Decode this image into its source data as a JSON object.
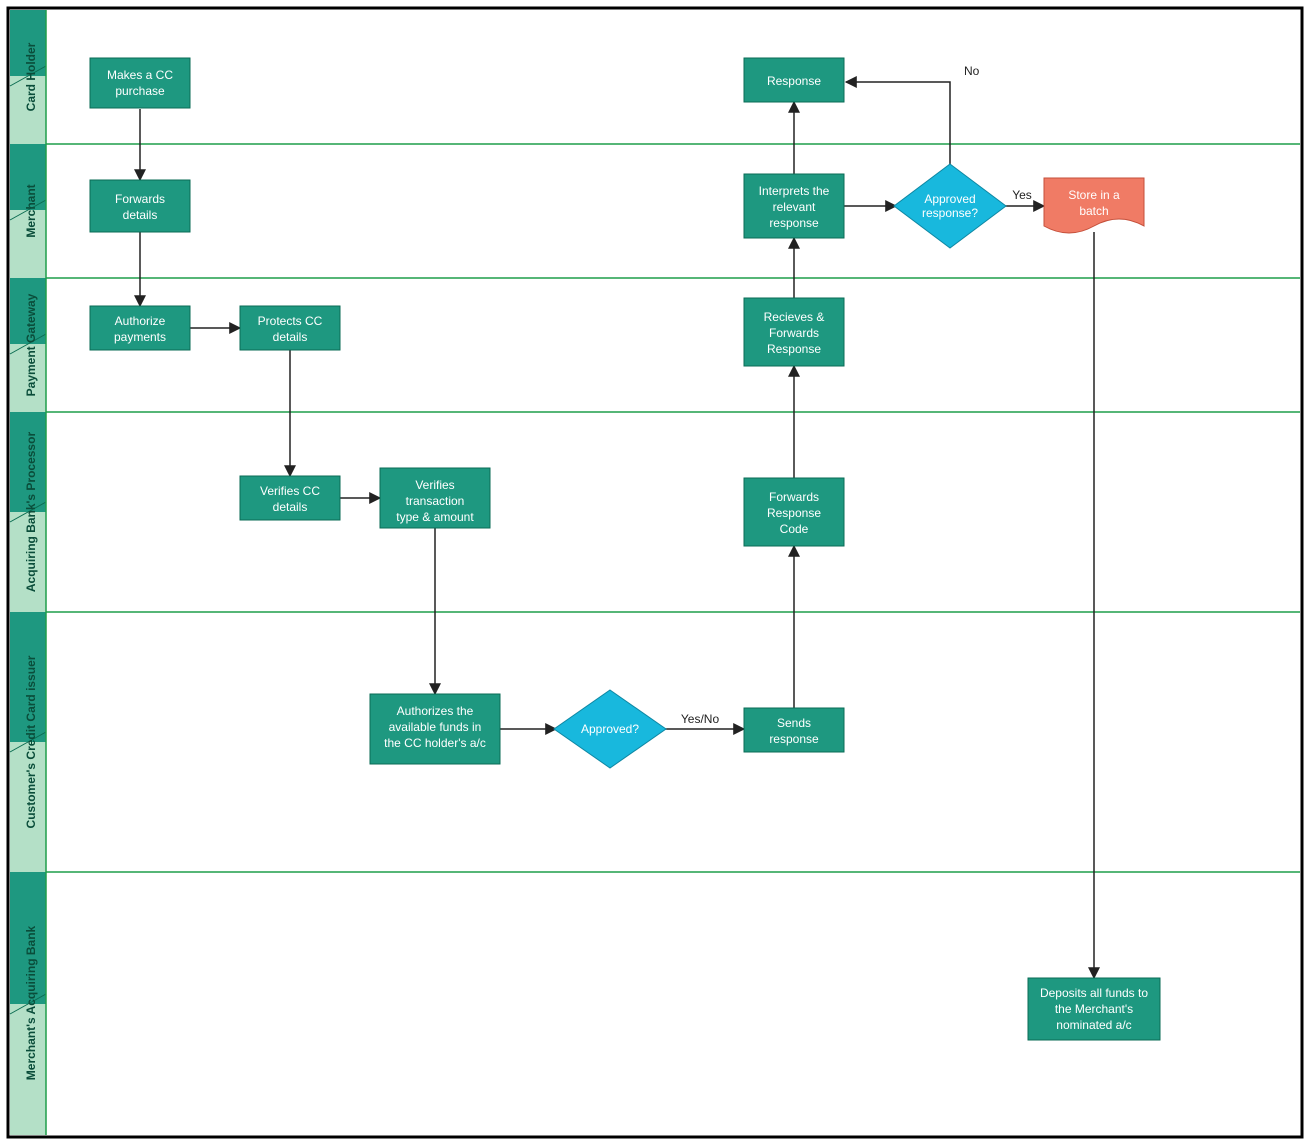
{
  "swimlanes": [
    {
      "id": "lane1",
      "label": "Card Holder"
    },
    {
      "id": "lane2",
      "label": "Merchant"
    },
    {
      "id": "lane3",
      "label": "Payment Gateway"
    },
    {
      "id": "lane4",
      "label": "Acquiring Bank's Processor"
    },
    {
      "id": "lane5",
      "label": "Customer's Credit Card issuer"
    },
    {
      "id": "lane6",
      "label": "Merchant's Acquiring Bank"
    }
  ],
  "nodes": {
    "makesCC": {
      "text": "Makes a CC purchase",
      "lane": "lane1",
      "type": "process"
    },
    "response": {
      "text": "Response",
      "lane": "lane1",
      "type": "process"
    },
    "forwardsDetails": {
      "text": "Forwards details",
      "lane": "lane2",
      "type": "process"
    },
    "interprets": {
      "text": "Interprets the relevant response",
      "lane": "lane2",
      "type": "process"
    },
    "approvedResp": {
      "text": "Approved response?",
      "lane": "lane2",
      "type": "decision"
    },
    "storeBatch": {
      "text": "Store in a batch",
      "lane": "lane2",
      "type": "document"
    },
    "authorizePay": {
      "text": "Authorize payments",
      "lane": "lane3",
      "type": "process"
    },
    "protectsCC": {
      "text": "Protects CC details",
      "lane": "lane3",
      "type": "process"
    },
    "receivesFwd": {
      "text": "Recieves & Forwards Response",
      "lane": "lane3",
      "type": "process"
    },
    "verifiesCC": {
      "text": "Verifies CC details",
      "lane": "lane4",
      "type": "process"
    },
    "verifiesTxn": {
      "text": "Verifies transaction type & amount",
      "lane": "lane4",
      "type": "process"
    },
    "fwdRespCode": {
      "text": "Forwards Response Code",
      "lane": "lane4",
      "type": "process"
    },
    "authFunds": {
      "text": "Authorizes the available funds in the CC holder's a/c",
      "lane": "lane5",
      "type": "process"
    },
    "approved": {
      "text": "Approved?",
      "lane": "lane5",
      "type": "decision"
    },
    "sendsResp": {
      "text": "Sends response",
      "lane": "lane5",
      "type": "process"
    },
    "deposits": {
      "text": "Deposits all funds to the Merchant's nominated a/c",
      "lane": "lane6",
      "type": "process"
    }
  },
  "edges": [
    {
      "from": "makesCC",
      "to": "forwardsDetails",
      "label": ""
    },
    {
      "from": "forwardsDetails",
      "to": "authorizePay",
      "label": ""
    },
    {
      "from": "authorizePay",
      "to": "protectsCC",
      "label": ""
    },
    {
      "from": "protectsCC",
      "to": "verifiesCC",
      "label": ""
    },
    {
      "from": "verifiesCC",
      "to": "verifiesTxn",
      "label": ""
    },
    {
      "from": "verifiesTxn",
      "to": "authFunds",
      "label": ""
    },
    {
      "from": "authFunds",
      "to": "approved",
      "label": ""
    },
    {
      "from": "approved",
      "to": "sendsResp",
      "label": "Yes/No"
    },
    {
      "from": "sendsResp",
      "to": "fwdRespCode",
      "label": ""
    },
    {
      "from": "fwdRespCode",
      "to": "receivesFwd",
      "label": ""
    },
    {
      "from": "receivesFwd",
      "to": "interprets",
      "label": ""
    },
    {
      "from": "interprets",
      "to": "response",
      "label": ""
    },
    {
      "from": "interprets",
      "to": "approvedResp",
      "label": ""
    },
    {
      "from": "approvedResp",
      "to": "storeBatch",
      "label": "Yes"
    },
    {
      "from": "approvedResp",
      "to": "response",
      "label": "No"
    },
    {
      "from": "storeBatch",
      "to": "deposits",
      "label": ""
    }
  ],
  "colors": {
    "process": "#1e9880",
    "decision": "#18b8dd",
    "document": "#f07b65",
    "laneHeaderDark": "#1e9880",
    "laneHeaderLight": "#b4e0c7",
    "laneDivider": "#1e9e4a",
    "border": "#000"
  }
}
